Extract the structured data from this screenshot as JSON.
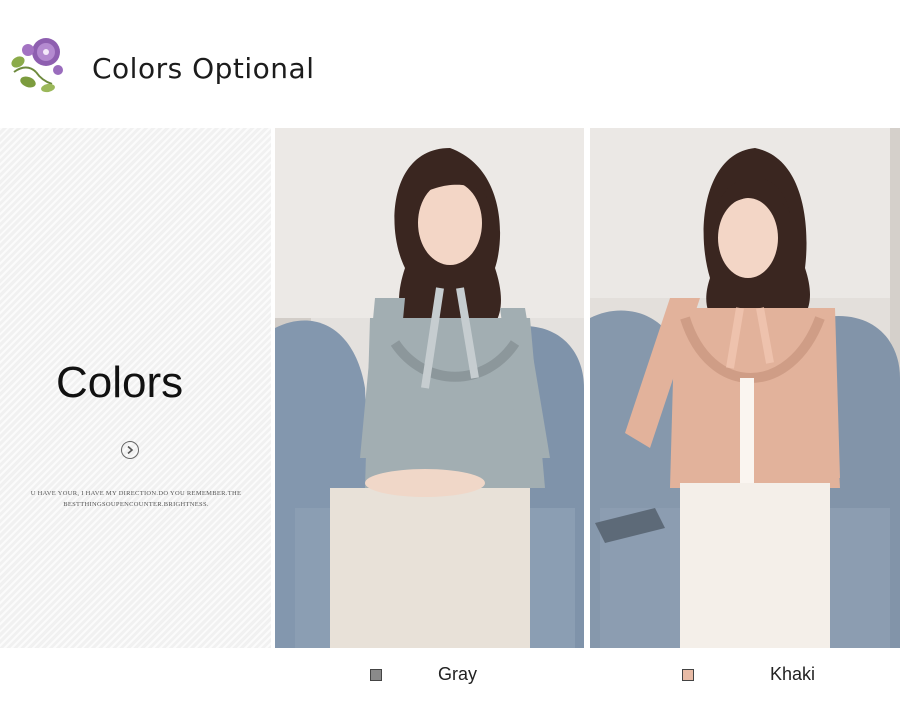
{
  "header": {
    "title": "Colors Optional",
    "logo_icon": "morning-glory-flower-icon"
  },
  "side_panel": {
    "title": "Colors",
    "arrow_icon": "chevron-right-circle-icon",
    "tagline_line1": "U HAVE YOUR, I HAVE MY DIRECTION.DO YOU REMEMBER.THE",
    "tagline_line2": "BESTTHINGSOUPENCOUNTER.BRIGHTNESS."
  },
  "colors": [
    {
      "label": "Gray",
      "swatch": "#8a8a8a"
    },
    {
      "label": "Khaki",
      "swatch": "#e8bba6"
    }
  ]
}
